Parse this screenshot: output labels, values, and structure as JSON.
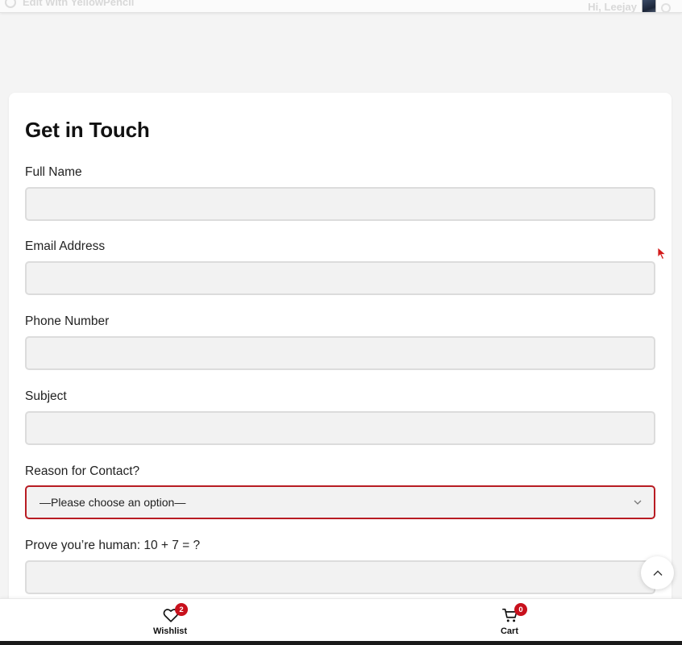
{
  "admin_bar": {
    "left_text": "Edit With YellowPencil",
    "right_text": "Hi, Leejay"
  },
  "form": {
    "title": "Get in Touch",
    "fields": [
      {
        "label": "Full Name",
        "value": ""
      },
      {
        "label": "Email Address",
        "value": ""
      },
      {
        "label": "Phone Number",
        "value": ""
      },
      {
        "label": "Subject",
        "value": ""
      },
      {
        "label": "Reason for Contact?",
        "value": "—Please choose an option—"
      },
      {
        "label": "Prove you’re human: 10 + 7 = ?",
        "value": ""
      }
    ]
  },
  "bottom_bar": {
    "wishlist": {
      "label": "Wishlist",
      "count": "2"
    },
    "cart": {
      "label": "Cart",
      "count": "0"
    }
  },
  "colors": {
    "accent": "#b81c23",
    "badge": "#c8101c",
    "field_bg": "#f2f2f2",
    "page_bg": "#f4f4f4"
  },
  "icons": {
    "scroll_top": "chevron-up-icon",
    "wishlist": "heart-icon",
    "cart": "cart-icon",
    "select": "chevron-down-icon"
  }
}
